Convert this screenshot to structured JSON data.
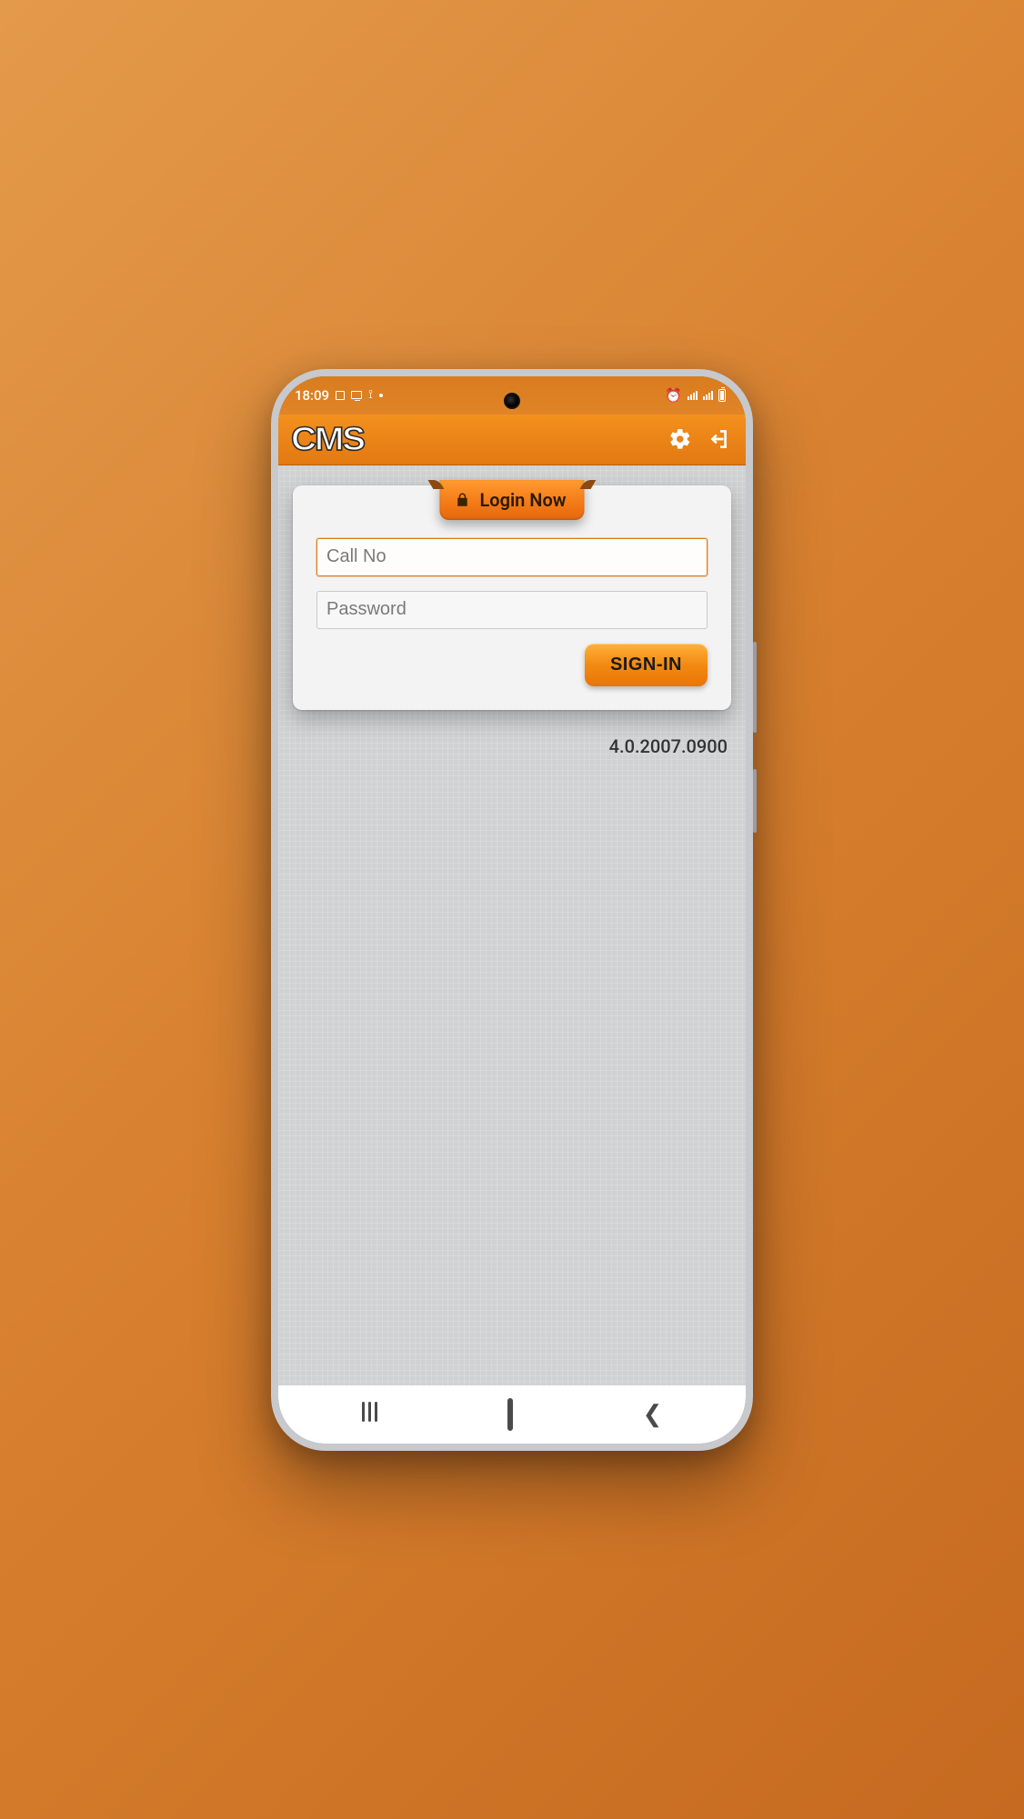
{
  "status": {
    "time": "18:09"
  },
  "header": {
    "brand": "CMS"
  },
  "login": {
    "tab_label": "Login Now",
    "callno_placeholder": "Call No",
    "callno_value": "",
    "password_placeholder": "Password",
    "password_value": "",
    "signin_label": "SIGN-IN"
  },
  "app": {
    "version": "4.0.2007.0900"
  }
}
